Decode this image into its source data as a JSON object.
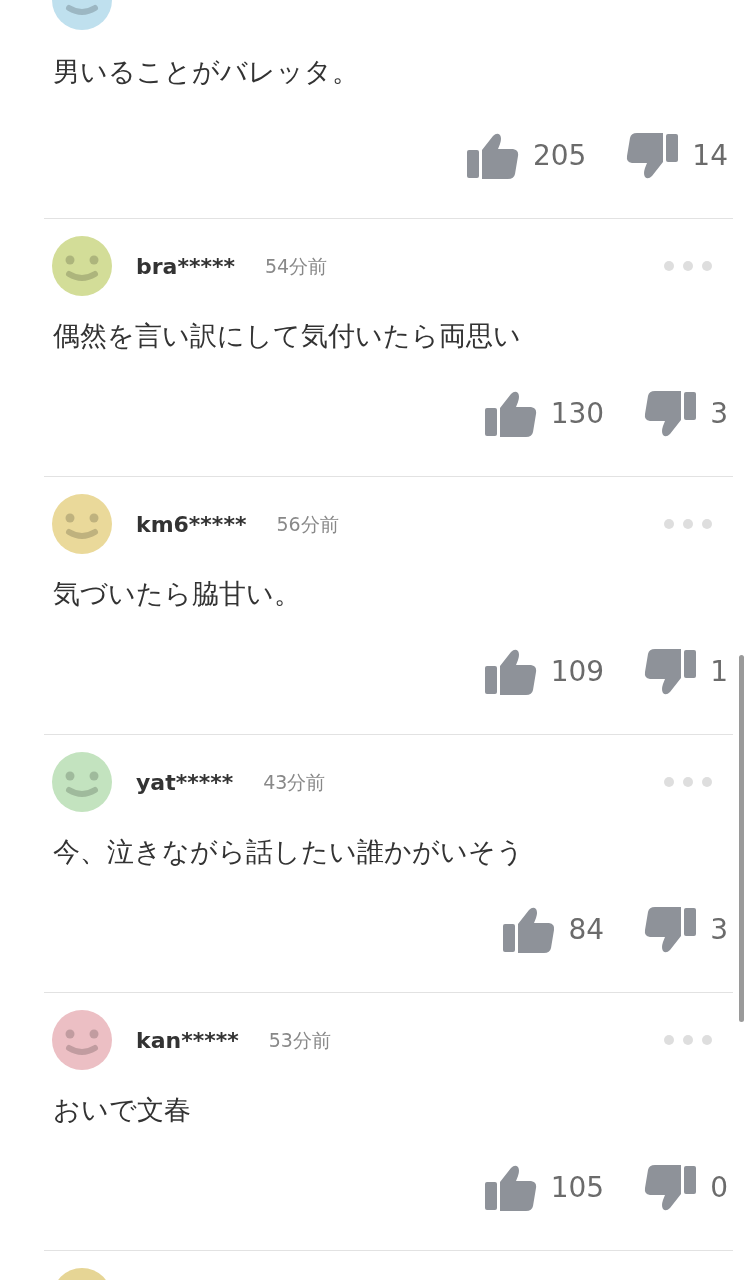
{
  "top_comment": {
    "color": "#bfe0ee",
    "body": "男いることがバレッタ。",
    "likes": "205",
    "dislikes": "14"
  },
  "comments": [
    {
      "color": "#d3dd98",
      "user": "bra*****",
      "time": "54分前",
      "body": "偶然を言い訳にして気付いたら両思い",
      "likes": "130",
      "dislikes": "3"
    },
    {
      "color": "#ead99a",
      "user": "km6*****",
      "time": "56分前",
      "body": "気づいたら脇甘い。",
      "likes": "109",
      "dislikes": "1"
    },
    {
      "color": "#c3e3bf",
      "user": "yat*****",
      "time": "43分前",
      "body": "今、泣きながら話したい誰かがいそう",
      "likes": "84",
      "dislikes": "3"
    },
    {
      "color": "#ecbfc4",
      "user": "kan*****",
      "time": "53分前",
      "body": "おいで文春",
      "likes": "105",
      "dislikes": "0"
    }
  ],
  "bottom_comment": {
    "color": "#e6d595"
  }
}
